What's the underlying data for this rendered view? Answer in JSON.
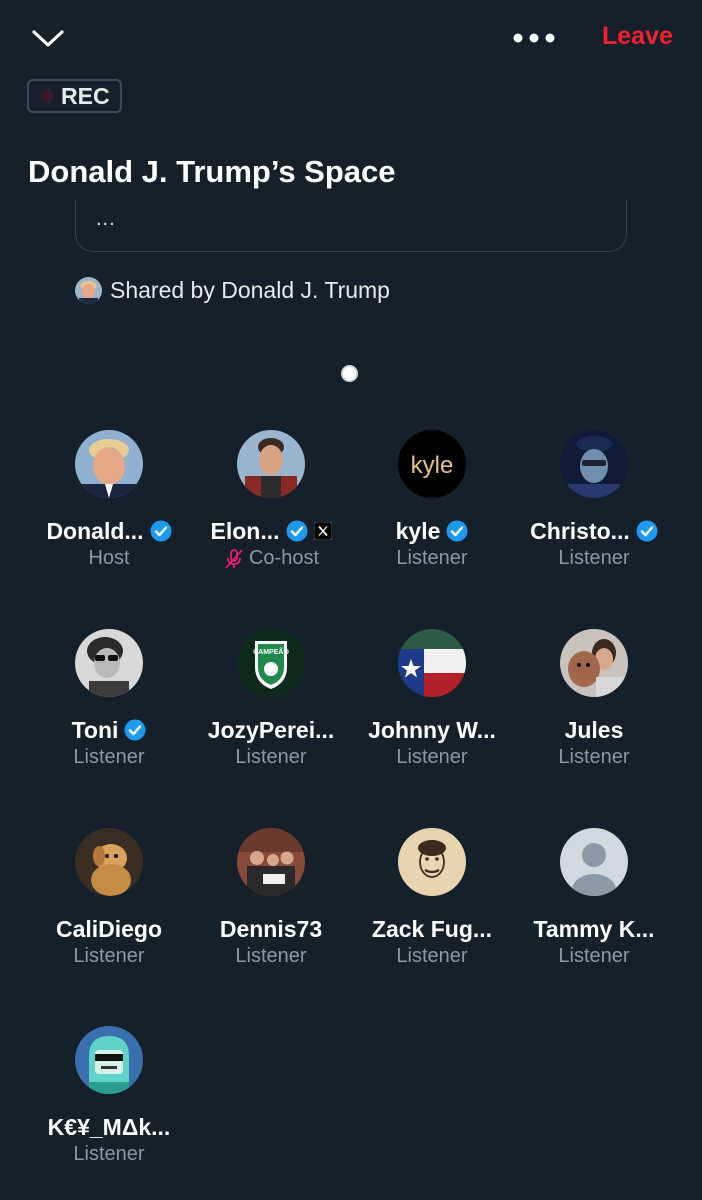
{
  "header": {
    "leave_label": "Leave",
    "rec_label": "REC",
    "title": "Donald J. Trump’s Space"
  },
  "tweet": {
    "preview_text": "...",
    "shared_by": "Shared by Donald J. Trump"
  },
  "participants": [
    {
      "name": "Donald...",
      "role": "Host",
      "verified": true,
      "avatar": "trump-avatar"
    },
    {
      "name": "Elon...",
      "role": "Co-host",
      "verified": true,
      "affiliate": "x-badge-icon",
      "muted": true,
      "avatar": "elon-avatar"
    },
    {
      "name": "kyle",
      "role": "Listener",
      "verified": true,
      "avatar": "kyle-avatar",
      "avatar_text": "kyle"
    },
    {
      "name": "Christo...",
      "role": "Listener",
      "verified": true,
      "avatar": "christo-avatar"
    },
    {
      "name": "Toni",
      "role": "Listener",
      "verified": true,
      "avatar": "toni-avatar"
    },
    {
      "name": "JozyPerei...",
      "role": "Listener",
      "avatar": "jozy-avatar",
      "avatar_text": "CAMPEÃO"
    },
    {
      "name": "Johnny W...",
      "role": "Listener",
      "avatar": "johnny-avatar"
    },
    {
      "name": "Jules",
      "role": "Listener",
      "avatar": "jules-avatar"
    },
    {
      "name": "CaliDiego",
      "role": "Listener",
      "avatar": "calidiego-avatar"
    },
    {
      "name": "Dennis73",
      "role": "Listener",
      "avatar": "dennis-avatar"
    },
    {
      "name": "Zack Fug...",
      "role": "Listener",
      "avatar": "zack-avatar"
    },
    {
      "name": "Tammy K...",
      "role": "Listener",
      "avatar": "default-avatar"
    },
    {
      "name": "K€¥_MΔk...",
      "role": "Listener",
      "avatar": "key-avatar"
    }
  ],
  "colors": {
    "background": "#15202b",
    "leave": "#f4212e",
    "verified": "#1d9bf0",
    "muted": "#f91880",
    "secondary_text": "#8b98a5"
  }
}
